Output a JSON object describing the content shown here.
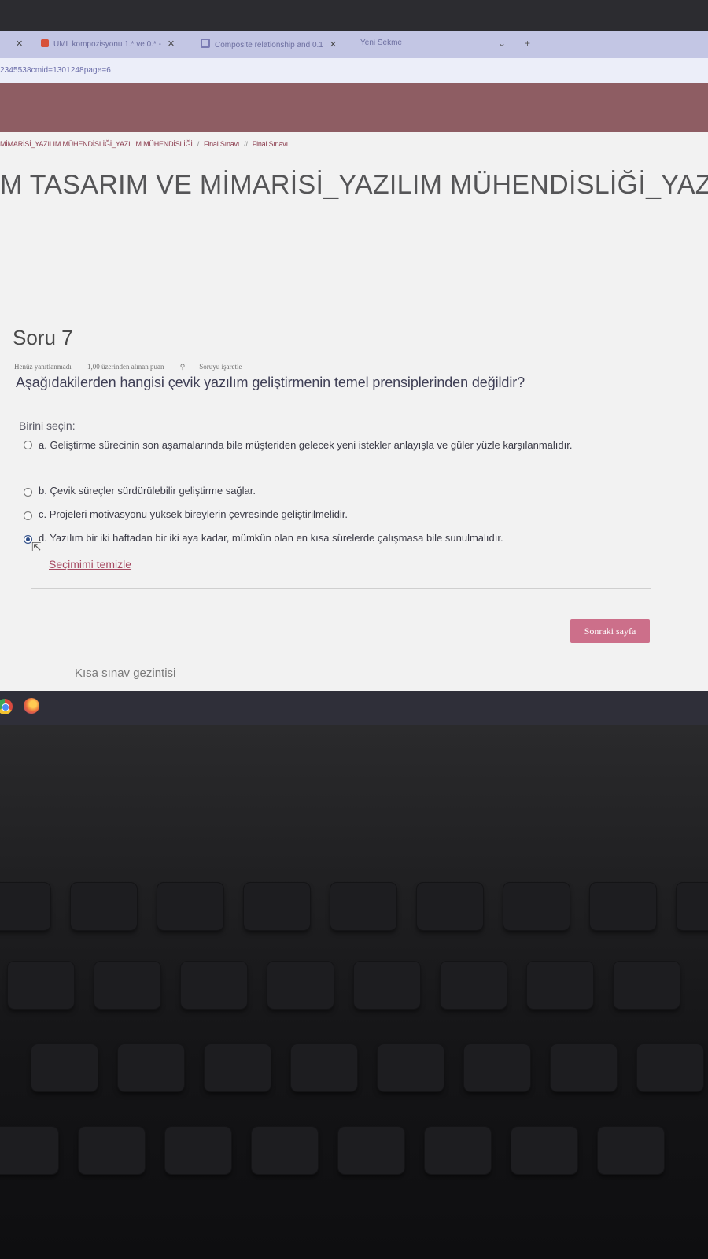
{
  "browser": {
    "tabs": [
      {
        "label": "UML kompozisyonu 1.* ve 0.* -"
      },
      {
        "label": "Composite relationship and 0.1"
      },
      {
        "label": "Yeni Sekme"
      }
    ],
    "url": "2345538cmid=1301248page=6"
  },
  "breadcrumb": {
    "course": "MİMARİSİ_YAZILIM MÜHENDİSLİĞİ_YAZILIM MÜHENDİSLİĞİ",
    "item1": "Final Sınavı",
    "item2": "Final Sınavı"
  },
  "course_title": "M TASARIM VE MİMARİSİ_YAZILIM MÜHENDİSLİĞİ_YAZ",
  "question": {
    "number": "Soru 7",
    "status": "Henüz yanıtlanmadı",
    "points": "1,00 üzerinden alınan puan",
    "flag": "Soruyu işaretle",
    "text": "Aşağıdakilerden hangisi çevik yazılım geliştirmenin temel prensiplerinden değildir?",
    "choose_label": "Birini seçin:",
    "options": [
      {
        "label": "a. Geliştirme sürecinin son aşamalarında bile müşteriden gelecek yeni istekler anlayışla ve güler yüzle karşılanmalıdır.",
        "selected": false
      },
      {
        "label": "b. Çevik süreçler sürdürülebilir geliştirme sağlar.",
        "selected": false
      },
      {
        "label": "c. Projeleri motivasyonu yüksek bireylerin çevresinde geliştirilmelidir.",
        "selected": false
      },
      {
        "label": "d. Yazılım bir iki haftadan bir iki aya kadar, mümkün olan en kısa sürelerde çalışmasa bile sunulmalıdır.",
        "selected": true
      }
    ],
    "clear_label": "Seçimimi temizle"
  },
  "next_button": "Sonraki sayfa",
  "quiz_nav": "Kısa sınav gezintisi",
  "colors": {
    "banner": "#8e5d63",
    "next_button": "#cc6f8a",
    "link": "#a74a62",
    "tab_bar": "#c3c6e4"
  }
}
